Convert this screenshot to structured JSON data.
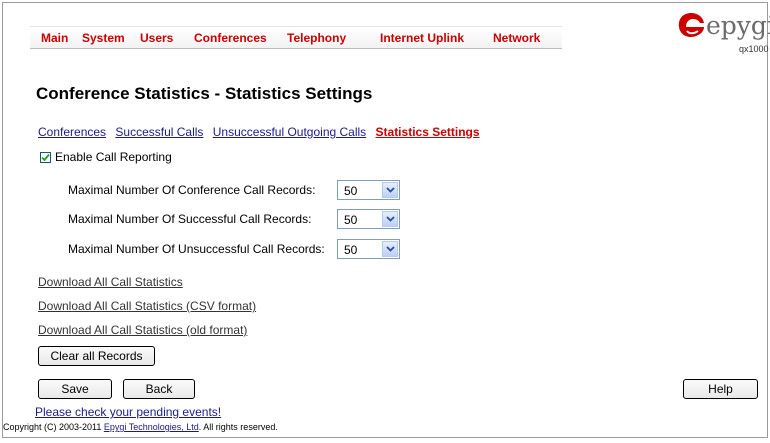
{
  "nav": [
    "Main",
    "System",
    "Users",
    "Conferences",
    "Telephony",
    "Internet Uplink",
    "Network"
  ],
  "logo": {
    "word": "epygi",
    "model": "qx1000"
  },
  "page_title": "Conference Statistics - Statistics Settings",
  "tabs": [
    {
      "label": "Conferences",
      "active": false
    },
    {
      "label": "Successful Calls",
      "active": false
    },
    {
      "label": "Unsuccessful Outgoing Calls",
      "active": false
    },
    {
      "label": "Statistics Settings",
      "active": true
    }
  ],
  "enable_reporting": {
    "label": "Enable Call Reporting",
    "checked": true
  },
  "settings": [
    {
      "label": "Maximal Number Of Conference Call Records:",
      "value": "50"
    },
    {
      "label": "Maximal Number Of Successful Call Records:",
      "value": "50"
    },
    {
      "label": "Maximal Number Of Unsuccessful Call Records:",
      "value": "50"
    }
  ],
  "downloads": [
    "Download All Call Statistics",
    "Download All Call Statistics (CSV format)",
    "Download All Call Statistics (old format)"
  ],
  "buttons": {
    "clear": "Clear all Records",
    "save": "Save",
    "back": "Back",
    "help": "Help"
  },
  "pending_events": "Please check your pending events!",
  "copyright": {
    "prefix": "Copyright (C) 2003-2011 ",
    "link": "Epygi Technologies, Ltd",
    "suffix": ". All rights reserved."
  },
  "colors": {
    "nav_red": "#cc0000",
    "link_blue": "#1a1a8a",
    "logo_red": "#cc0000",
    "logo_gray": "#6b6b6b"
  }
}
